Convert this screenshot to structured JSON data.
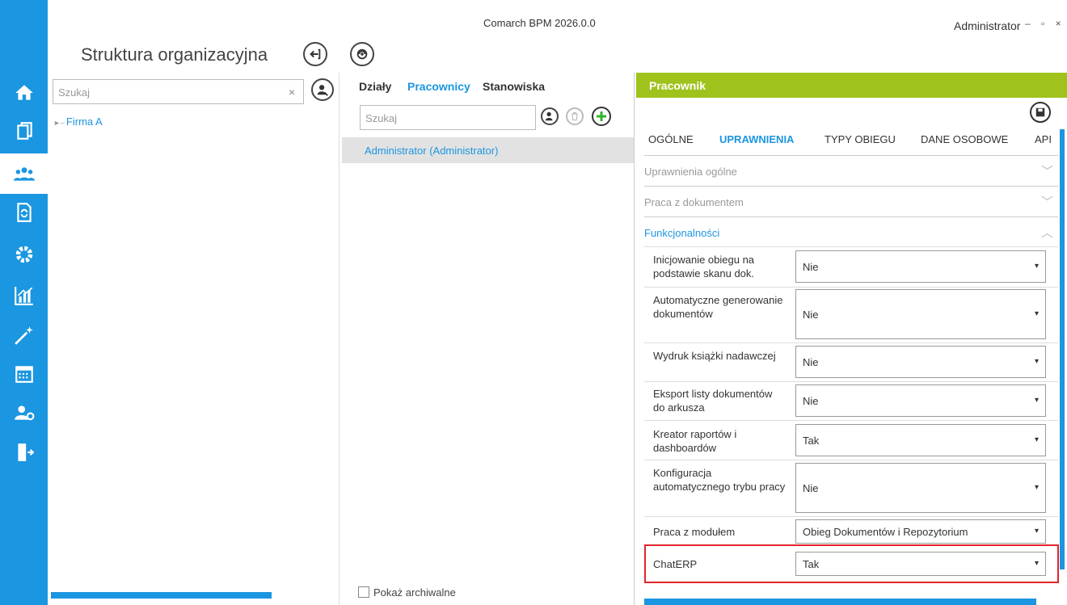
{
  "app": {
    "title": "Comarch BPM 2026.0.0",
    "user": "Administrator",
    "window_controls": "– ▫ ×"
  },
  "page": {
    "title": "Struktura organizacyjna"
  },
  "sidebar": {
    "items": [
      {
        "name": "home-icon"
      },
      {
        "name": "documents-icon"
      },
      {
        "name": "users-icon",
        "active": true
      },
      {
        "name": "document-refresh-icon"
      },
      {
        "name": "gear-icon"
      },
      {
        "name": "chart-icon"
      },
      {
        "name": "magic-wand-icon"
      },
      {
        "name": "calendar-icon"
      },
      {
        "name": "user-settings-icon"
      },
      {
        "name": "exit-icon"
      }
    ]
  },
  "left": {
    "search_placeholder": "Szukaj",
    "clear": "×",
    "tree": [
      {
        "label": "Firma A"
      }
    ]
  },
  "middle": {
    "tabs": [
      "Działy",
      "Pracownicy",
      "Stanowiska"
    ],
    "active_tab": "Pracownicy",
    "search_placeholder": "Szukaj",
    "selected_employee": "Administrator (Administrator)",
    "archive_checkbox_label": "Pokaż archiwalne"
  },
  "right": {
    "header": "Pracownik",
    "tabs": [
      "OGÓLNE",
      "UPRAWNIENIA",
      "TYPY OBIEGU",
      "DANE OSOBOWE",
      "API"
    ],
    "active_tab": "UPRAWNIENIA",
    "sections": [
      {
        "label": "Uprawnienia ogólne",
        "open": false
      },
      {
        "label": "Praca z dokumentem",
        "open": false
      },
      {
        "label": "Funkcjonalności",
        "open": true
      }
    ],
    "rows": [
      {
        "label": "Inicjowanie obiegu na podstawie skanu dok.",
        "value": "Nie"
      },
      {
        "label": "Automatyczne generowanie dokumentów",
        "value": "Nie"
      },
      {
        "label": "Wydruk książki nadawczej",
        "value": "Nie"
      },
      {
        "label": "Eksport listy dokumentów do arkusza",
        "value": "Nie"
      },
      {
        "label": "Kreator raportów i dashboardów",
        "value": "Tak"
      },
      {
        "label": "Konfiguracja automatycznego trybu pracy",
        "value": "Nie"
      },
      {
        "label": "Praca z modułem",
        "value": "Obieg Dokumentów i Repozytorium"
      },
      {
        "label": "ChatERP",
        "value": "Tak"
      }
    ]
  },
  "colors": {
    "accent": "#1b96e0",
    "header_green": "#a0c21d",
    "highlight_red": "#e0252b"
  }
}
